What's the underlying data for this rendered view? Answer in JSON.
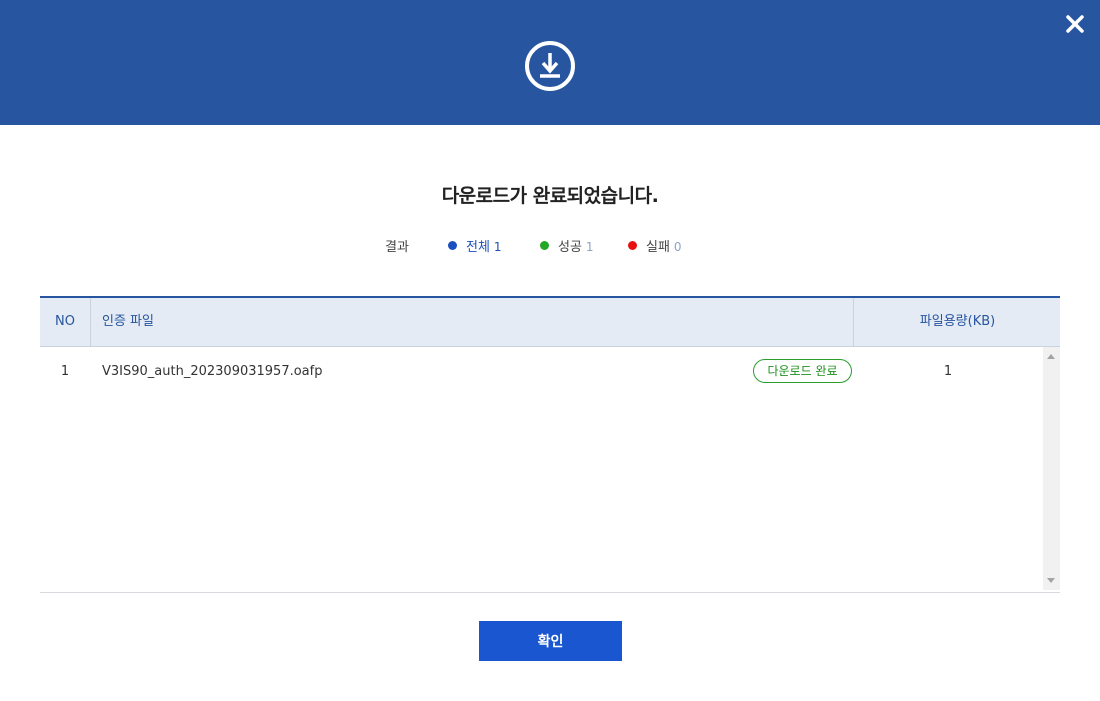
{
  "header": {
    "icon": "download-icon",
    "close_icon": "close-icon",
    "colors": {
      "background": "#27559f"
    }
  },
  "title": "다운로드가 완료되었습니다.",
  "result": {
    "label": "결과",
    "total": {
      "label": "전체",
      "count": "1",
      "color": "#1a4fbf"
    },
    "success": {
      "label": "성공",
      "count": "1",
      "color": "#22a822"
    },
    "fail": {
      "label": "실패",
      "count": "0",
      "color": "#e81010"
    }
  },
  "table": {
    "columns": {
      "no": "NO",
      "file": "인증 파일",
      "size": "파일용량(KB)"
    },
    "rows": [
      {
        "no": "1",
        "file": "V3IS90_auth_202309031957.oafp",
        "status": "다운로드 완료",
        "size": "1"
      }
    ]
  },
  "footer": {
    "confirm_label": "확인",
    "confirm_color": "#1a56d0"
  }
}
